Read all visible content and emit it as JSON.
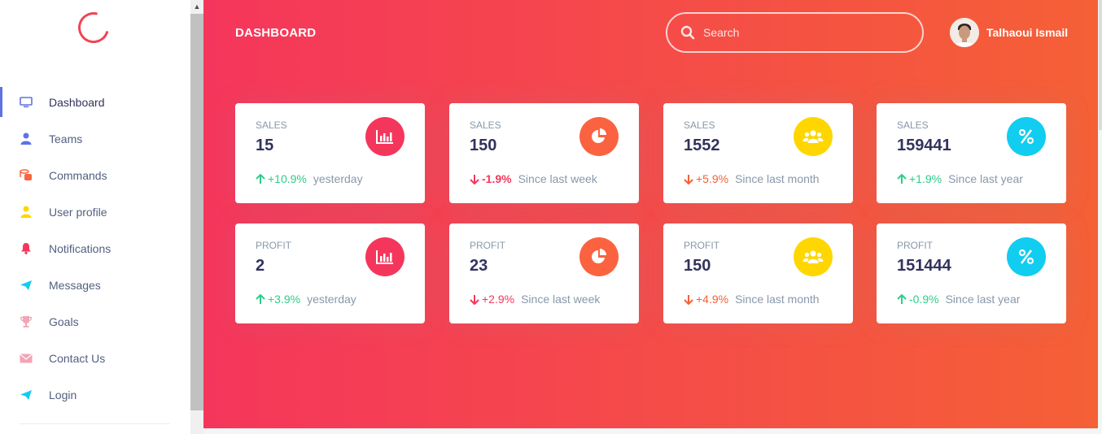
{
  "sidebar": {
    "items": [
      {
        "label": "Dashboard",
        "icon": "monitor-icon",
        "color": "#5e72e4",
        "active": true
      },
      {
        "label": "Teams",
        "icon": "user-icon",
        "color": "#5e72e4"
      },
      {
        "label": "Commands",
        "icon": "coins-icon",
        "color": "#fb6340"
      },
      {
        "label": "User profile",
        "icon": "user-icon",
        "color": "#ffd600"
      },
      {
        "label": "Notifications",
        "icon": "bell-icon",
        "color": "#f5365c"
      },
      {
        "label": "Messages",
        "icon": "send-icon",
        "color": "#11cdef"
      },
      {
        "label": "Goals",
        "icon": "trophy-icon",
        "color": "#f3a4b5"
      },
      {
        "label": "Contact Us",
        "icon": "envelope-icon",
        "color": "#f3a4b5"
      },
      {
        "label": "Login",
        "icon": "send-icon",
        "color": "#11cdef"
      }
    ]
  },
  "header": {
    "title": "DASHBOARD",
    "search_placeholder": "Search",
    "user_name": "Talhaoui Ismail"
  },
  "colors": {
    "gradient_start": "#f5365c",
    "gradient_end": "#f56036",
    "up": "#2dce89",
    "down": "#f5365c"
  },
  "cards": [
    {
      "label": "SALES",
      "value": "15",
      "icon": "chart-bar-icon",
      "icon_bg": "#f5365c",
      "trend": "up",
      "change": "+10.9%",
      "caption": "yesterday"
    },
    {
      "label": "SALES",
      "value": "150",
      "icon": "chart-pie-icon",
      "icon_bg": "#fb6340",
      "trend": "down",
      "change": "-1.9%",
      "caption": "Since last week"
    },
    {
      "label": "SALES",
      "value": "1552",
      "icon": "users-icon",
      "icon_bg": "#ffd600",
      "trend": "down",
      "change": "+5.9%",
      "caption": "Since last month"
    },
    {
      "label": "SALES",
      "value": "159441",
      "icon": "percent-icon",
      "icon_bg": "#11cdef",
      "trend": "up",
      "change": "+1.9%",
      "caption": "Since last year"
    },
    {
      "label": "PROFIT",
      "value": "2",
      "icon": "chart-bar-icon",
      "icon_bg": "#f5365c",
      "trend": "up",
      "change": "+3.9%",
      "caption": "yesterday"
    },
    {
      "label": "PROFIT",
      "value": "23",
      "icon": "chart-pie-icon",
      "icon_bg": "#fb6340",
      "trend": "down",
      "change": "+2.9%",
      "caption": "Since last week"
    },
    {
      "label": "PROFIT",
      "value": "150",
      "icon": "users-icon",
      "icon_bg": "#ffd600",
      "trend": "down",
      "change": "+4.9%",
      "caption": "Since last month"
    },
    {
      "label": "PROFIT",
      "value": "151444",
      "icon": "percent-icon",
      "icon_bg": "#11cdef",
      "trend": "up",
      "change": "-0.9%",
      "caption": "Since last year"
    }
  ]
}
